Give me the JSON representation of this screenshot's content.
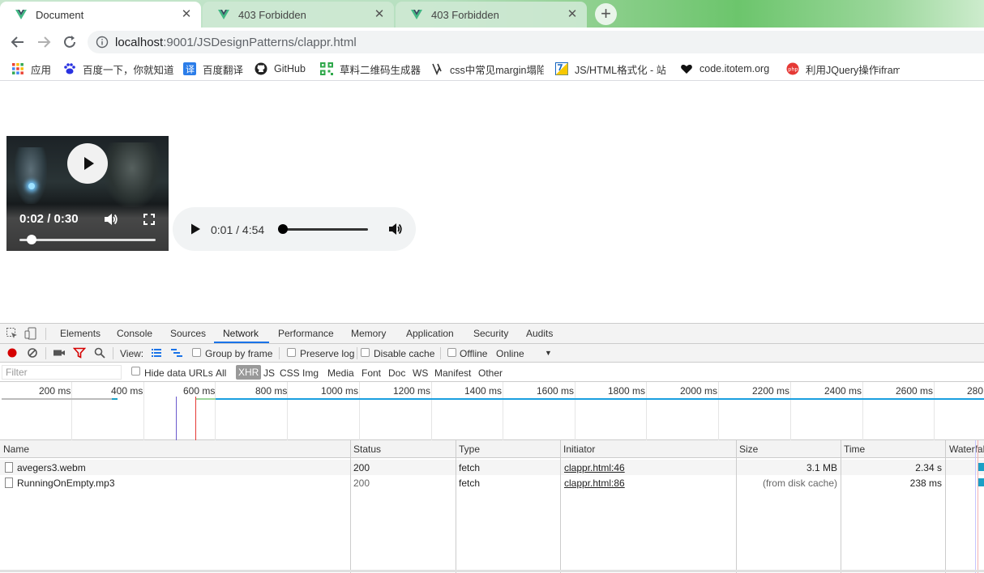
{
  "browser": {
    "tabs": [
      {
        "title": "Document",
        "active": true
      },
      {
        "title": "403 Forbidden",
        "active": false
      },
      {
        "title": "403 Forbidden",
        "active": false
      }
    ],
    "address": {
      "host": "localhost",
      "path": ":9001/JSDesignPatterns/clappr.html"
    },
    "bookmarks": [
      {
        "label": "应用",
        "icon": "apps-grid-icon"
      },
      {
        "label": "百度一下，你就知道",
        "icon": "baidu-paw-icon"
      },
      {
        "label": "百度翻译",
        "icon": "translate-icon"
      },
      {
        "label": "GitHub",
        "icon": "github-icon"
      },
      {
        "label": "草料二维码生成器",
        "icon": "qrcode-icon"
      },
      {
        "label": "css中常见margin塌陷",
        "icon": "css-icon"
      },
      {
        "label": "JS/HTML格式化 - 站长",
        "icon": "js-format-icon"
      },
      {
        "label": "code.itotem.org",
        "icon": "heart-icon"
      },
      {
        "label": "利用JQuery操作iframe",
        "icon": "php-icon"
      }
    ]
  },
  "page": {
    "video": {
      "time": "0:02 / 0:30",
      "progress": 0.07
    },
    "audio": {
      "time": "0:01 / 4:54",
      "progress": 0.003
    }
  },
  "devtools": {
    "tabs": [
      "Elements",
      "Console",
      "Sources",
      "Network",
      "Performance",
      "Memory",
      "Application",
      "Security",
      "Audits"
    ],
    "selected_tab": "Network",
    "toolbar": {
      "view_label": "View:",
      "group_by_frame": "Group by frame",
      "preserve_log": "Preserve log",
      "disable_cache": "Disable cache",
      "offline": "Offline",
      "throttle": "Online"
    },
    "filter": {
      "placeholder": "Filter",
      "hide_data_urls": "Hide data URLs",
      "types": [
        "All",
        "XHR",
        "JS",
        "CSS",
        "Img",
        "Media",
        "Font",
        "Doc",
        "WS",
        "Manifest",
        "Other"
      ],
      "selected_type": "XHR"
    },
    "overview_ticks": [
      "200 ms",
      "400 ms",
      "600 ms",
      "800 ms",
      "1000 ms",
      "1200 ms",
      "1400 ms",
      "1600 ms",
      "1800 ms",
      "2000 ms",
      "2200 ms",
      "2400 ms",
      "2600 ms",
      "280"
    ],
    "columns": [
      "Name",
      "Status",
      "Type",
      "Initiator",
      "Size",
      "Time",
      "Waterfall"
    ],
    "rows": [
      {
        "name": "avegers3.webm",
        "status": "200",
        "type": "fetch",
        "initiator": "clappr.html:46",
        "size": "3.1 MB",
        "time": "2.34 s"
      },
      {
        "name": "RunningOnEmpty.mp3",
        "status": "200",
        "type": "fetch",
        "initiator": "clappr.html:86",
        "size": "(from disk cache)",
        "time": "238 ms"
      }
    ]
  },
  "colors": {
    "accent": "#1a73e8",
    "record": "#d50000",
    "waterfall": "#1ba0c6"
  }
}
